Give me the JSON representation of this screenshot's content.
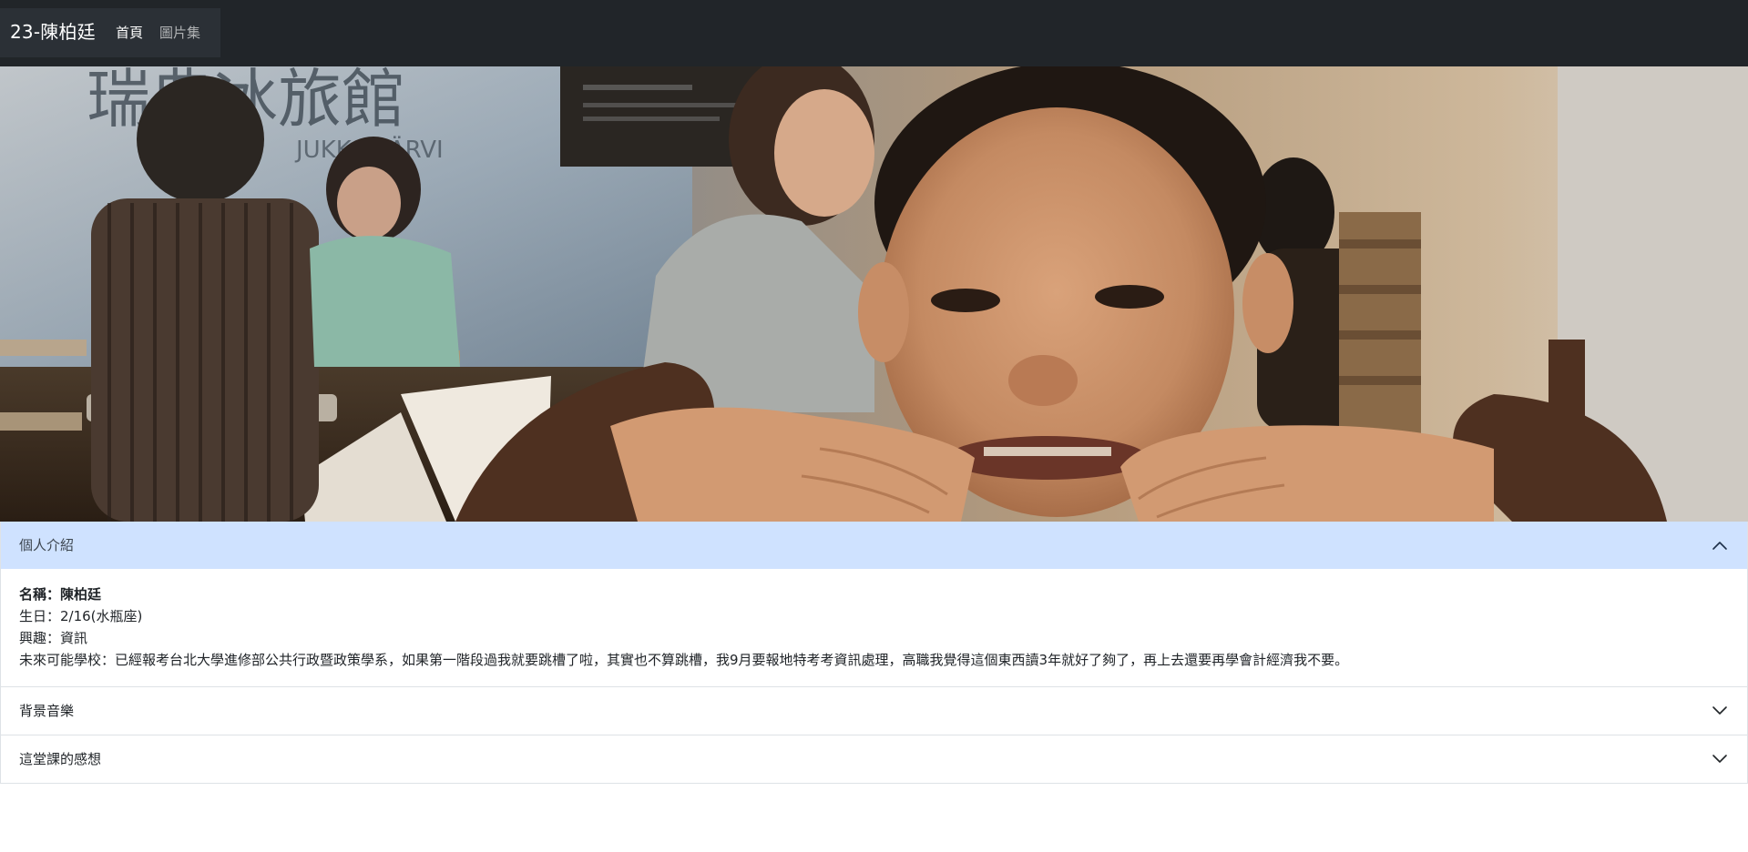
{
  "navbar": {
    "brand": "23-陳柏廷",
    "links": [
      {
        "label": "首頁",
        "active": true
      },
      {
        "label": "圖片集",
        "active": false
      }
    ]
  },
  "hero": {
    "image_description_icon": "photo-icon"
  },
  "accordion": {
    "items": [
      {
        "title": "個人介紹",
        "expanded": true,
        "body": {
          "name_line": "名稱：陳柏廷",
          "birthday_line": "生日：2/16(水瓶座)",
          "interest_line": "興趣：資訊",
          "school_line": "未來可能學校：已經報考台北大學進修部公共行政暨政策學系，如果第一階段過我就要跳槽了啦，其實也不算跳槽，我9月要報地特考考資訊處理，高職我覺得這個東西讀3年就好了夠了，再上去還要再學會計經濟我不要。"
        }
      },
      {
        "title": "背景音樂",
        "expanded": false
      },
      {
        "title": "這堂課的感想",
        "expanded": false
      }
    ]
  },
  "colors": {
    "navbar_bg": "#212529",
    "accordion_open_bg": "#cfe2ff",
    "border": "#dee2e6"
  }
}
